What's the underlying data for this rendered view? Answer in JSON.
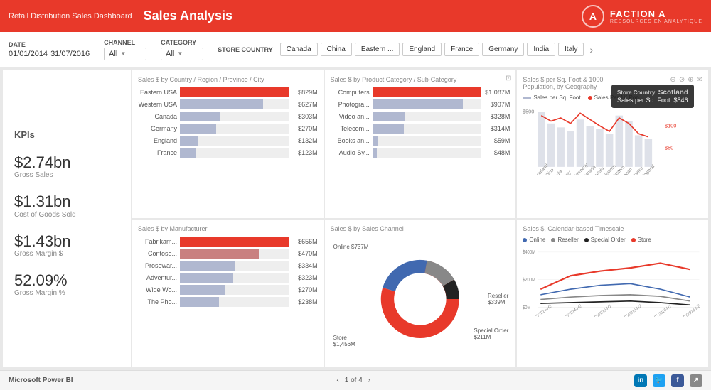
{
  "header": {
    "subtitle": "Retail Distribution Sales Dashboard",
    "title": "Sales Analysis",
    "logo_letter": "A",
    "logo_name": "FACTION A",
    "logo_sub": "RESSOURCES EN ANALYTIQUE"
  },
  "filters": {
    "date_label": "Date",
    "date_from": "01/01/2014",
    "date_to": "31/07/2016",
    "channel_label": "Channel",
    "channel_value": "All",
    "category_label": "Category",
    "category_value": "All",
    "store_country_label": "Store Country",
    "countries": [
      "Canada",
      "China",
      "Eastern ...",
      "England",
      "France",
      "Germany",
      "India",
      "Italy"
    ]
  },
  "kpis": {
    "title": "KPIs",
    "items": [
      {
        "value": "$2.74bn",
        "label": "Gross Sales"
      },
      {
        "value": "$1.31bn",
        "label": "Cost of Goods Sold"
      },
      {
        "value": "$1.43bn",
        "label": "Gross Margin $"
      },
      {
        "value": "52.09%",
        "label": "Gross Margin %"
      }
    ]
  },
  "country_region": {
    "title": "Sales $ by Country / Region / Province / City",
    "bars": [
      {
        "name": "Eastern USA",
        "value": "$829M",
        "pct": 100,
        "type": "red"
      },
      {
        "name": "Western USA",
        "value": "$627M",
        "pct": 76,
        "type": "blue"
      },
      {
        "name": "Canada",
        "value": "$303M",
        "pct": 37,
        "type": "blue"
      },
      {
        "name": "Germany",
        "value": "$270M",
        "pct": 33,
        "type": "blue"
      },
      {
        "name": "England",
        "value": "$132M",
        "pct": 16,
        "type": "blue"
      },
      {
        "name": "France",
        "value": "$123M",
        "pct": 15,
        "type": "blue"
      }
    ]
  },
  "product_category": {
    "title": "Sales $ by Product Category / Sub-Category",
    "bars": [
      {
        "name": "Computers",
        "value": "$1,087M",
        "pct": 100,
        "type": "red"
      },
      {
        "name": "Photogra...",
        "value": "$907M",
        "pct": 83,
        "type": "blue"
      },
      {
        "name": "Video an...",
        "value": "$328M",
        "pct": 30,
        "type": "blue"
      },
      {
        "name": "Telecom...",
        "value": "$314M",
        "pct": 29,
        "type": "blue"
      },
      {
        "name": "Books an...",
        "value": "$59M",
        "pct": 5,
        "type": "blue"
      },
      {
        "name": "Audio Sy...",
        "value": "$48M",
        "pct": 4,
        "type": "blue"
      }
    ]
  },
  "geo": {
    "title": "Sales $ per Sq. Foot & 1000 Population, by Geography",
    "legend": [
      "Sales per Sq. Foot",
      "Sales Per 1K Pop"
    ],
    "tooltip": {
      "country": "Scotland",
      "label1": "Store Country",
      "label2": "Sales per Sq. Foot",
      "value2": "$546"
    },
    "y_labels": [
      "$500",
      "$100",
      "$50"
    ]
  },
  "manufacturer": {
    "title": "Sales $ by Manufacturer",
    "bars": [
      {
        "name": "Fabrikam...",
        "value": "$656M",
        "pct": 100,
        "type": "red"
      },
      {
        "name": "Contoso...",
        "value": "$470M",
        "pct": 72,
        "type": "pink"
      },
      {
        "name": "Prosewar...",
        "value": "$334M",
        "pct": 51,
        "type": "blue"
      },
      {
        "name": "Adventur...",
        "value": "$323M",
        "pct": 49,
        "type": "blue"
      },
      {
        "name": "Wide Wo...",
        "value": "$270M",
        "pct": 41,
        "type": "blue"
      },
      {
        "name": "The Pho...",
        "value": "$238M",
        "pct": 36,
        "type": "blue"
      }
    ]
  },
  "sales_channel": {
    "title": "Sales $ by Sales Channel",
    "segments": [
      {
        "label": "Online",
        "value": "$737M",
        "color": "#4169b0",
        "pct": 30
      },
      {
        "label": "Reseller",
        "value": "$339M",
        "color": "#888",
        "pct": 14
      },
      {
        "label": "Special Order",
        "value": "$211M",
        "color": "#222",
        "pct": 8
      },
      {
        "label": "Store",
        "value": "$1,456M",
        "color": "#e8392a",
        "pct": 48
      }
    ]
  },
  "timescale": {
    "title": "Sales $, Calendar-based Timescale",
    "legend": [
      {
        "label": "Online",
        "color": "#4169b0",
        "type": "line"
      },
      {
        "label": "Reseller",
        "color": "#888",
        "type": "line"
      },
      {
        "label": "Special Order",
        "color": "#222",
        "type": "line"
      },
      {
        "label": "Store",
        "color": "#e8392a",
        "type": "line"
      }
    ],
    "y_labels": [
      "$400M",
      "$200M",
      "$0M"
    ],
    "x_labels": [
      "CY2014-H2",
      "CY2014-H2",
      "CY2015-H1",
      "CY2015-H2",
      "CY2016-H1",
      "CY2016-H2"
    ]
  },
  "footer": {
    "brand": "Microsoft Power BI",
    "page": "1 of 4",
    "social": [
      "in",
      "🐦",
      "f",
      "↗"
    ]
  }
}
